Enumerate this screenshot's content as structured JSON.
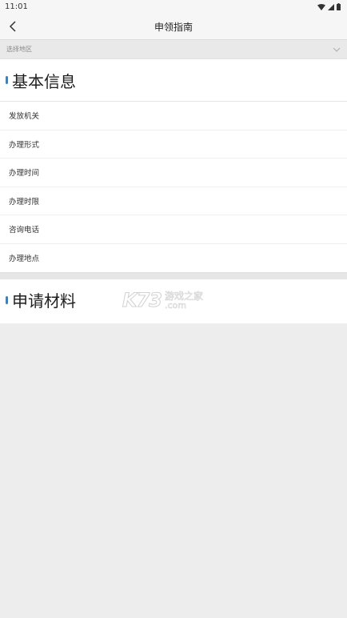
{
  "status_bar": {
    "time": "11:01"
  },
  "nav": {
    "title": "申领指南"
  },
  "region": {
    "placeholder": "选择地区"
  },
  "basic_info": {
    "title": "基本信息",
    "rows": [
      {
        "label": "发放机关"
      },
      {
        "label": "办理形式"
      },
      {
        "label": "办理时间"
      },
      {
        "label": "办理时限"
      },
      {
        "label": "咨询电话"
      },
      {
        "label": "办理地点"
      }
    ]
  },
  "materials": {
    "title": "申请材料"
  },
  "watermark": {
    "brand": "K73",
    "cn": "游戏之家",
    "domain": ".com"
  },
  "colors": {
    "accent": "#1e88e5",
    "background": "#ededed"
  }
}
